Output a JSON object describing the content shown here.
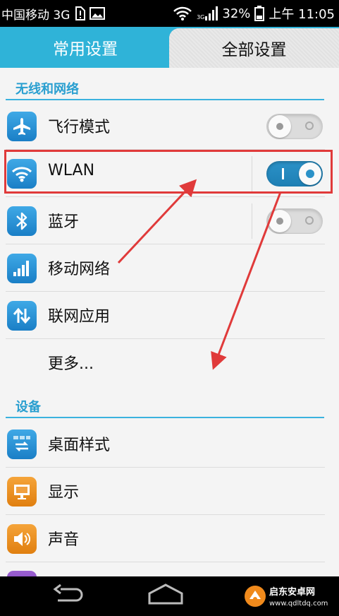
{
  "status_bar": {
    "carrier": "中国移动 3G",
    "network_small": "3G",
    "battery_percent": "32%",
    "time": "上午 11:05"
  },
  "tabs": [
    {
      "label": "常用设置",
      "selected": false
    },
    {
      "label": "全部设置",
      "selected": true
    }
  ],
  "sections": {
    "wireless": {
      "header": "无线和网络",
      "items": [
        {
          "label": "飞行模式",
          "icon": "airplane-icon",
          "toggle": "off"
        },
        {
          "label": "WLAN",
          "icon": "wifi-icon",
          "toggle": "on"
        },
        {
          "label": "蓝牙",
          "icon": "bluetooth-icon",
          "toggle": "off"
        },
        {
          "label": "移动网络",
          "icon": "signal-bars-icon"
        },
        {
          "label": "联网应用",
          "icon": "data-arrows-icon"
        },
        {
          "label": "更多..."
        }
      ]
    },
    "device": {
      "header": "设备",
      "items": [
        {
          "label": "桌面样式",
          "icon": "home-style-icon"
        },
        {
          "label": "显示",
          "icon": "display-icon"
        },
        {
          "label": "声音",
          "icon": "speaker-icon"
        }
      ]
    }
  },
  "watermark": {
    "title": "启东安卓网",
    "url": "www.qdltdq.com"
  },
  "colors": {
    "accent": "#2fb3d8",
    "highlight": "#e03a3a",
    "toggle_on": "#2b92c8"
  }
}
